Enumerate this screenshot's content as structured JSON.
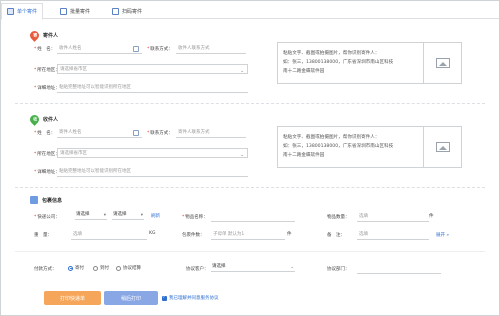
{
  "tabs": [
    {
      "label": "单个寄件",
      "icon": "single-ship-icon"
    },
    {
      "label": "批量寄件",
      "icon": "batch-ship-icon"
    },
    {
      "label": "扫码寄件",
      "icon": "qr-code-icon"
    }
  ],
  "sender": {
    "pin_text": "寄",
    "title": "寄件人",
    "name_label": "姓　名：",
    "name_placeholder": "收件人姓名",
    "phone_label": "联系方式：",
    "phone_placeholder": "收件人联系方式",
    "region_label": "所在地区：",
    "region_placeholder": "请选择省市区",
    "address_label": "详细地址：",
    "address_placeholder": "粘贴完整地址可以智能识别所在地区",
    "paste_lines": [
      "粘贴文字、截图或拍摄图片，帮你识别寄件人：",
      "如：张三，13800138000，广东省深圳市南山区科技",
      "南十二路金蝶软件园"
    ]
  },
  "receiver": {
    "pin_text": "收",
    "title": "收件人",
    "name_label": "姓　名：",
    "name_placeholder": "寄件人姓名",
    "phone_label": "联系方式：",
    "phone_placeholder": "寄件人联系方式",
    "region_label": "所在地区：",
    "region_placeholder": "请选择省市区",
    "address_label": "详细地址：",
    "address_placeholder": "粘贴完整地址可以智能识别所在地区",
    "paste_lines": [
      "粘贴文字、截图或拍摄图片，帮你识别寄件人：",
      "如：张三，13800138000，广东省深圳市南山区科技",
      "南十二路金蝶软件园"
    ]
  },
  "package": {
    "title": "包裹信息",
    "courier_label": "快递公司：",
    "courier_select1": "请选择",
    "courier_select2": "请选择",
    "refresh_link": "刷新",
    "item_name_label": "物品名称：",
    "item_qty_label": "物品数量：",
    "item_qty_value": "选填",
    "item_qty_unit": "件",
    "weight_label": "重　量：",
    "weight_value": "选填",
    "weight_unit": "KG",
    "pkg_count_label": "包裹件数：",
    "pkg_count_value": "子母单 默认为1",
    "pkg_count_unit": "件",
    "remark_label": "备　注：",
    "remark_value": "选填",
    "expand_link": "展开 »"
  },
  "payment": {
    "label": "付款方式：",
    "options": [
      "寄付",
      "到付",
      "协议结算"
    ],
    "selected_index": 0,
    "customer_label": "协议客户：",
    "customer_select": "请选择",
    "dept_label": "协议部门："
  },
  "actions": {
    "print_label": "打印快递单",
    "ship_label": "稍后打印",
    "agree_text": "我已理解并同意服务协议",
    "agree_checked": true
  },
  "colors": {
    "accent": "#2f6fd1",
    "orange": "#f6a65a",
    "red_pin": "#e75a3e",
    "green_pin": "#46b04a"
  }
}
